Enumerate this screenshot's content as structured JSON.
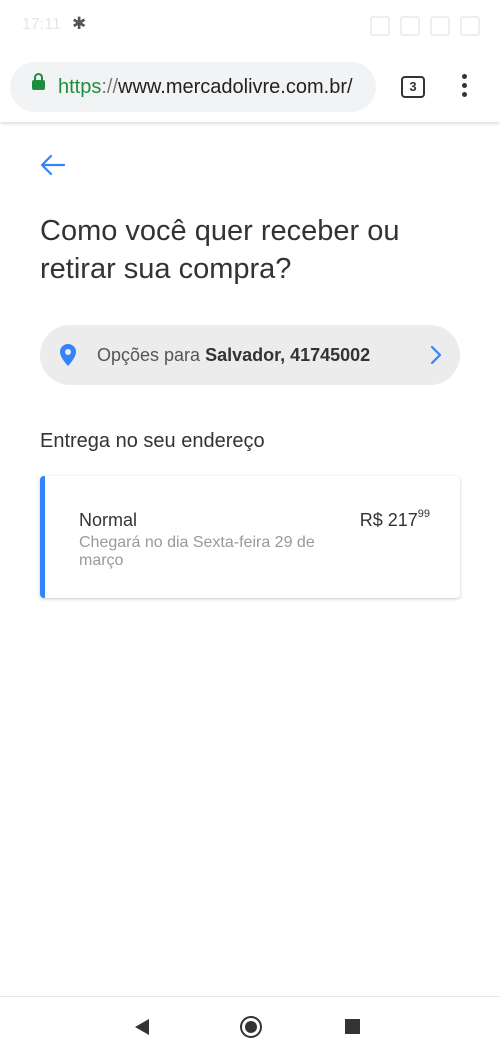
{
  "status_bar": {
    "time": "17:11",
    "bluetooth_icon": "bluetooth-icon"
  },
  "browser": {
    "url_scheme": "https",
    "url_sep": "://",
    "url_host": "www.mercadolivre.com.br/",
    "tab_count": "3"
  },
  "page": {
    "title": "Como você quer receber ou retirar sua compra?",
    "location": {
      "prefix": "Opções para ",
      "place": "Salvador, 41745002"
    },
    "section_title": "Entrega no seu endereço",
    "option": {
      "name": "Normal",
      "eta": "Chegará no dia Sexta-feira 29 de março",
      "price_main": "R$ 217",
      "price_cents": "99"
    }
  },
  "colors": {
    "accent": "#3483fa",
    "secure_green": "#1e8e3e"
  }
}
